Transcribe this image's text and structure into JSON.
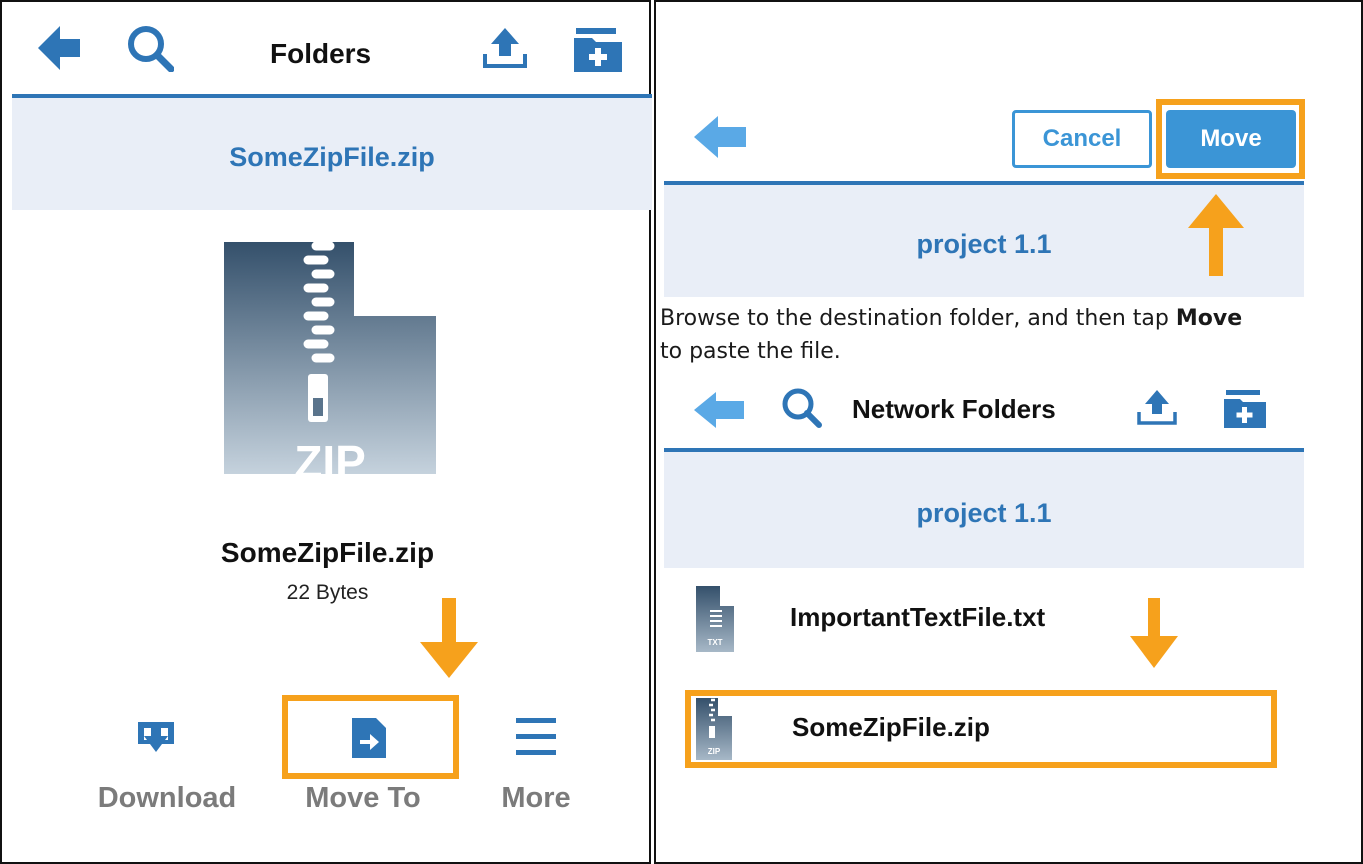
{
  "left": {
    "header": {
      "title": "Folders",
      "icons": [
        "back-arrow-icon",
        "search-icon",
        "upload-icon",
        "new-folder-icon"
      ]
    },
    "banner": {
      "title": "SomeZipFile.zip"
    },
    "file": {
      "icon": "zip-file-icon",
      "icon_label": "ZIP",
      "name": "SomeZipFile.zip",
      "size": "22 Bytes"
    },
    "actions": [
      {
        "icon": "download-icon",
        "label": "Download"
      },
      {
        "icon": "move-to-icon",
        "label": "Move To"
      },
      {
        "icon": "hamburger-menu-icon",
        "label": "More"
      }
    ]
  },
  "right": {
    "move_bar": {
      "cancel_label": "Cancel",
      "move_label": "Move"
    },
    "top_banner": {
      "title": "project 1.1"
    },
    "instruction": {
      "before": "Browse to the destination folder, and then tap ",
      "bold": "Move",
      "after": " to paste the file."
    },
    "header": {
      "title": "Network Folders"
    },
    "folder_banner": {
      "title": "project 1.1"
    },
    "files": [
      {
        "icon_label": "TXT",
        "name": "ImportantTextFile.txt"
      },
      {
        "icon_label": "ZIP",
        "name": "SomeZipFile.zip"
      }
    ]
  },
  "colors": {
    "accent_blue": "#2e75b6",
    "light_blue": "#5aa9e6",
    "highlight_orange": "#f6a11c",
    "band_bg": "#e9eef7"
  }
}
